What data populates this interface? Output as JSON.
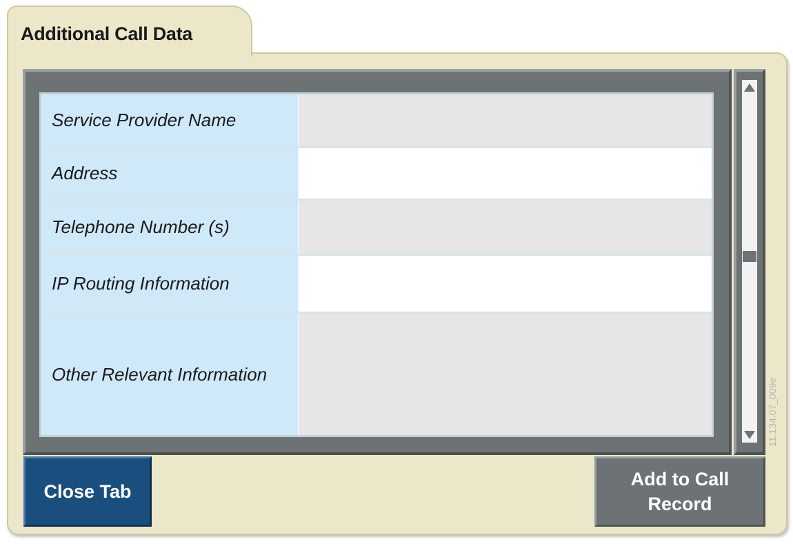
{
  "tab": {
    "title": "Additional Call Data"
  },
  "form": {
    "fields": [
      {
        "label": "Service Provider Name",
        "value": ""
      },
      {
        "label": "Address",
        "value": ""
      },
      {
        "label": "Telephone Number (s)",
        "value": ""
      },
      {
        "label": "IP Routing Information",
        "value": ""
      },
      {
        "label": "Other Relevant Information",
        "value": ""
      }
    ]
  },
  "scrollbar": {
    "position_fraction": 0.5
  },
  "buttons": {
    "close": "Close Tab",
    "add": "Add to Call Record"
  },
  "figure_code": "11.134.07_009e"
}
